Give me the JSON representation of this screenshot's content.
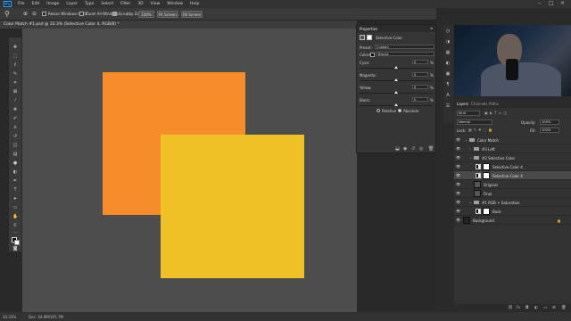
{
  "menubar": {
    "logo": "Ps",
    "items": [
      "File",
      "Edit",
      "Image",
      "Layer",
      "Type",
      "Select",
      "Filter",
      "3D",
      "View",
      "Window",
      "Help"
    ]
  },
  "options": {
    "resize_windows": "Resize Windows to Fit",
    "zoom_all": "Zoom All Windows",
    "scrubby_zoom": "Scrubby Zoom",
    "zoom_100": "100%",
    "fit_screen": "Fit Screen",
    "fill_screen": "Fill Screen"
  },
  "document": {
    "tab_title": "Color Match #1.psd @ 33.3% (Selective Color 4, RGB/8) *",
    "zoom": "33.33%",
    "doc_size": "Doc: 44.9M/175.7M"
  },
  "properties": {
    "title": "Properties",
    "adjustment": "Selective Color",
    "preset_label": "Preset:",
    "preset_value": "Custom",
    "colors_label": "Colors:",
    "colors_value": "Blacks",
    "sliders": [
      {
        "label": "Cyan:",
        "value": "0",
        "unit": "%"
      },
      {
        "label": "Magenta:",
        "value": "0",
        "unit": "%"
      },
      {
        "label": "Yellow:",
        "value": "0",
        "unit": "%"
      },
      {
        "label": "Black:",
        "value": "0",
        "unit": "%"
      }
    ],
    "relative": "Relative",
    "absolute": "Absolute",
    "method_selected": "Absolute"
  },
  "layers": {
    "tabs": [
      "Layers",
      "Channels",
      "Paths"
    ],
    "active_tab": "Layers",
    "filter": "Kind",
    "blend_mode": "Normal",
    "opacity_label": "Opacity:",
    "opacity": "100%",
    "lock_label": "Lock:",
    "fill_label": "Fill:",
    "fill": "100%",
    "rows": [
      {
        "name": "Color Match",
        "type": "group",
        "indent": 0,
        "visible": true,
        "selected": false
      },
      {
        "name": "#3 Left",
        "type": "group",
        "indent": 1,
        "visible": true,
        "selected": false
      },
      {
        "name": "#2 Selective Color",
        "type": "group",
        "indent": 1,
        "visible": true,
        "selected": false
      },
      {
        "name": "Selective Color 4",
        "type": "adjustment",
        "indent": 2,
        "visible": true,
        "selected": false
      },
      {
        "name": "Selective Color 4",
        "type": "adjustment",
        "indent": 2,
        "visible": true,
        "selected": true
      },
      {
        "name": "Original",
        "type": "layer",
        "indent": 2,
        "visible": true,
        "selected": false
      },
      {
        "name": "Final",
        "type": "layer",
        "indent": 2,
        "visible": true,
        "selected": false
      },
      {
        "name": "#1 RGB + Saturation",
        "type": "group",
        "indent": 1,
        "visible": true,
        "selected": false
      },
      {
        "name": "Back",
        "type": "layer",
        "indent": 2,
        "visible": true,
        "selected": false
      },
      {
        "name": "Background",
        "type": "background",
        "indent": 0,
        "visible": true,
        "selected": false
      }
    ]
  },
  "colors": {
    "orange": "#f78c2b",
    "yellow": "#f0c126",
    "canvas": "#4d4d4d",
    "accent": "#31a8ff"
  }
}
